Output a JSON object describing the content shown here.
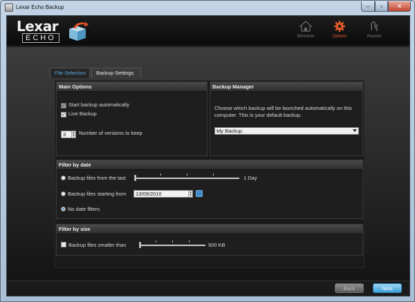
{
  "window": {
    "title": "Lexar Echo Backup"
  },
  "logo": {
    "brand": "Lexar",
    "product": "ECHO"
  },
  "nav": [
    {
      "label": "Welcome",
      "icon": "house-icon",
      "active": false
    },
    {
      "label": "Options",
      "icon": "gear-icon",
      "active": true
    },
    {
      "label": "Restore",
      "icon": "restore-icon",
      "active": false
    }
  ],
  "tabs": {
    "file_selection": "File Selection",
    "backup_settings": "Backup Settings"
  },
  "main_options": {
    "title": "Main Options",
    "start_auto": "Start backup automatically",
    "live_backup": "Live Backup",
    "versions_value": "3",
    "versions_label": "Number of versions to keep"
  },
  "backup_manager": {
    "title": "Backup Manager",
    "description": "Choose which backup will be launched automatically on this computer. This is your default backup.",
    "selected": "My Backup"
  },
  "filter_date": {
    "title": "Filter by date",
    "option_last": "Backup files from the last",
    "last_value": "1 Day",
    "option_starting": "Backup files starting from",
    "start_date": "13/09/2010",
    "option_none": "No date filters"
  },
  "filter_size": {
    "title": "Filter by size",
    "option_smaller": "Backup files smaller than",
    "size_value": "500 KB"
  },
  "footer": {
    "back": "Back",
    "next": "Next"
  },
  "colors": {
    "accent": "#e05a2a",
    "link": "#5aa6df",
    "next_button": "#3c9fd8"
  }
}
